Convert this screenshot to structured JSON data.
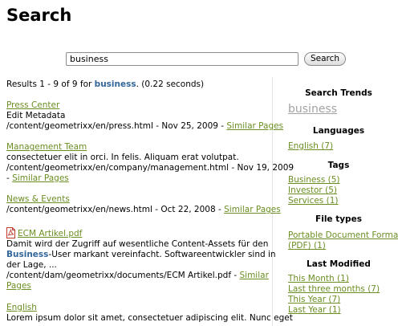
{
  "page": {
    "title": "Search"
  },
  "search": {
    "query": "business",
    "button_label": "Search"
  },
  "summary": {
    "prefix": "Results 1 - 9 of 9 for ",
    "term": "business",
    "suffix": ". (0.22 seconds)"
  },
  "results": [
    {
      "title": "Press Center",
      "excerpt": "Edit Metadata",
      "path": "/content/geometrixx/en/press.html",
      "date": "Nov 25, 2009",
      "similar": "Similar Pages"
    },
    {
      "title": "Management Team",
      "excerpt": "consectetuer elit in orci. In felis. Aliquam erat volutpat.",
      "path": "/content/geometrixx/en/company/management.html",
      "date": "Nov 19, 2009",
      "similar": "Similar Pages"
    },
    {
      "title": "News & Events",
      "path": "/content/geometrixx/en/news.html",
      "date": "Oct 22, 2008",
      "similar": "Similar Pages"
    },
    {
      "title": "ECM Artikel.pdf",
      "icon": "pdf-icon",
      "excerpt_line1": "Damit wird der Zugriff auf wesentliche Content-Assets für den",
      "excerpt_kw": "Business",
      "excerpt_line2_rest": "-User markant vereinfacht. Softwareentwickler sind in",
      "excerpt_line3": "der Lage, ...",
      "path": "/content/dam/geometrixx/documents/ECM Artikel.pdf",
      "similar_part1": "Similar",
      "similar_part2": "Pages"
    },
    {
      "title": "English",
      "excerpt": "Lorem ipsum dolor sit amet, consectetuer adipiscing elit. Nunc eget"
    }
  ],
  "sidebar": {
    "trends": {
      "heading": "Search Trends",
      "items": [
        "business"
      ]
    },
    "languages": {
      "heading": "Languages",
      "items": [
        "English (7)"
      ]
    },
    "tags": {
      "heading": "Tags",
      "items": [
        "Business (5)",
        "Investor (5)",
        "Services (1)"
      ]
    },
    "file_types": {
      "heading": "File types",
      "items": [
        "Portable Document Format",
        "(PDF) (1)"
      ]
    },
    "last_modified": {
      "heading": "Last Modified",
      "items": [
        "This Month (1)",
        "Last three months (7)",
        "This Year (7)",
        "Last Year (1)"
      ]
    }
  },
  "colors": {
    "link": "#6b8e23",
    "keyword": "#336699",
    "trend": "#a3a3a3"
  }
}
